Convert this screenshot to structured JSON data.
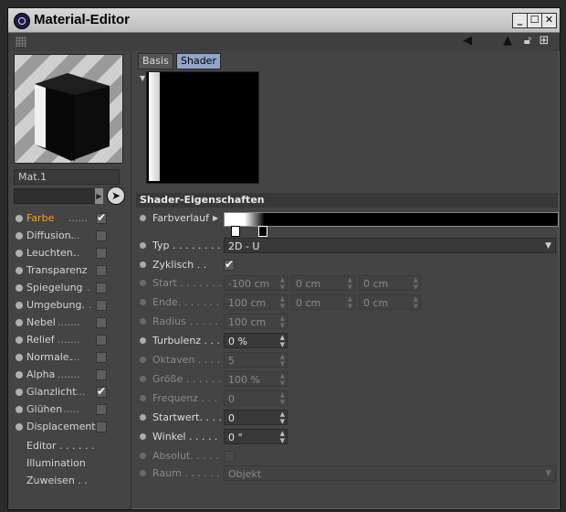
{
  "window": {
    "title": "Material-Editor",
    "controls": [
      "_",
      "☐",
      "✕"
    ]
  },
  "toolbar": {
    "icons": [
      "back-arrow-icon",
      "pointer-icon",
      "lock-icon",
      "new-window-icon"
    ]
  },
  "material": {
    "name": "Mat.1"
  },
  "channels": [
    {
      "label": "Farbe",
      "dots": "......",
      "checked": "✔",
      "active": true
    },
    {
      "label": "Diffusion.",
      "dots": "...",
      "checked": ""
    },
    {
      "label": "Leuchten.",
      "dots": "...",
      "checked": ""
    },
    {
      "label": "Transparenz",
      "dots": "",
      "checked": ""
    },
    {
      "label": "Spiegelung",
      "dots": ".",
      "checked": ""
    },
    {
      "label": "Umgebung.",
      "dots": ".",
      "checked": ""
    },
    {
      "label": "Nebel",
      "dots": ".......",
      "checked": ""
    },
    {
      "label": "Relief",
      "dots": ".......",
      "checked": ""
    },
    {
      "label": "Normale.",
      "dots": "...",
      "checked": ""
    },
    {
      "label": "Alpha",
      "dots": ".......",
      "checked": ""
    },
    {
      "label": "Glanzlicht",
      "dots": "...",
      "checked": "✔"
    },
    {
      "label": "Glühen",
      "dots": ".....",
      "checked": ""
    },
    {
      "label": "Displacement",
      "dots": "",
      "checked": ""
    }
  ],
  "extras": [
    "Editor . . . . . .",
    "Illumination",
    "Zuweisen . ."
  ],
  "tabs": [
    "Basis",
    "Shader"
  ],
  "section": {
    "title": "Shader-Eigenschaften"
  },
  "props": {
    "farbverlauf": "Farbverlauf",
    "typ": {
      "label": "Typ . . . . . . . .",
      "value": "2D - U"
    },
    "zyklisch": {
      "label": "Zyklisch . .",
      "checked": "✔"
    },
    "start": {
      "label": "Start . . . . . . .",
      "values": [
        "-100 cm",
        "0 cm",
        "0 cm"
      ]
    },
    "ende": {
      "label": "Ende. . . . . . .",
      "values": [
        "100 cm",
        "0 cm",
        "0 cm"
      ]
    },
    "radius": {
      "label": "Radius . . . . .",
      "value": "100 cm"
    },
    "turbulenz": {
      "label": "Turbulenz . . .",
      "value": "0 %"
    },
    "oktaven": {
      "label": "Oktaven . . . .",
      "value": "5"
    },
    "groesse": {
      "label": "Größe . . . . . .",
      "value": "100 %"
    },
    "frequenz": {
      "label": "Frequenz . . .",
      "value": "0"
    },
    "startwert": {
      "label": "Startwert. . . .",
      "value": "0"
    },
    "winkel": {
      "label": "Winkel . . . . .",
      "value": "0 °"
    },
    "absolut": {
      "label": "Absolut. . . . .",
      "checked": ""
    },
    "raum": {
      "label": "Raum . . . . . .",
      "value": "Objekt"
    }
  }
}
